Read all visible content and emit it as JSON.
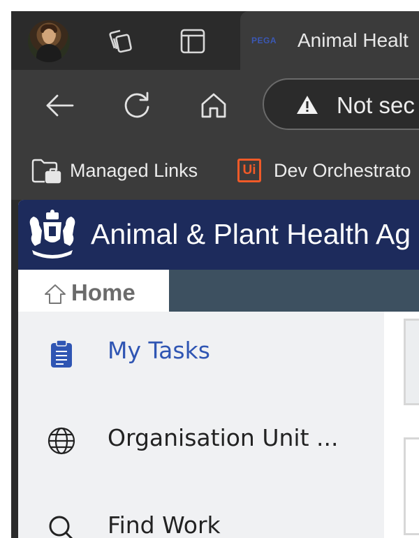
{
  "browser": {
    "tab": {
      "favicon_text": "PEGA",
      "title": "Animal Healt"
    },
    "address_bar": {
      "security_text": "Not sec"
    },
    "bookmarks": [
      {
        "label": "Managed Links"
      },
      {
        "label": "Dev Orchestrato",
        "logo_text": "Ui"
      }
    ]
  },
  "page": {
    "banner_title": "Animal & Plant Health Ag",
    "nav": {
      "home_label": "Home"
    },
    "sidebar": {
      "items": [
        {
          "label": "My Tasks",
          "icon": "clipboard-icon",
          "color": "#2f55b3"
        },
        {
          "label": "Organisation Unit ...",
          "icon": "globe-icon",
          "color": "#222222"
        },
        {
          "label": "Find Work",
          "icon": "search-icon",
          "color": "#222222"
        }
      ]
    }
  },
  "colors": {
    "banner_bg": "#1d2b5c",
    "nav_bg": "#3d5060",
    "accent": "#2f55b3",
    "uipath_orange": "#f05a28"
  }
}
